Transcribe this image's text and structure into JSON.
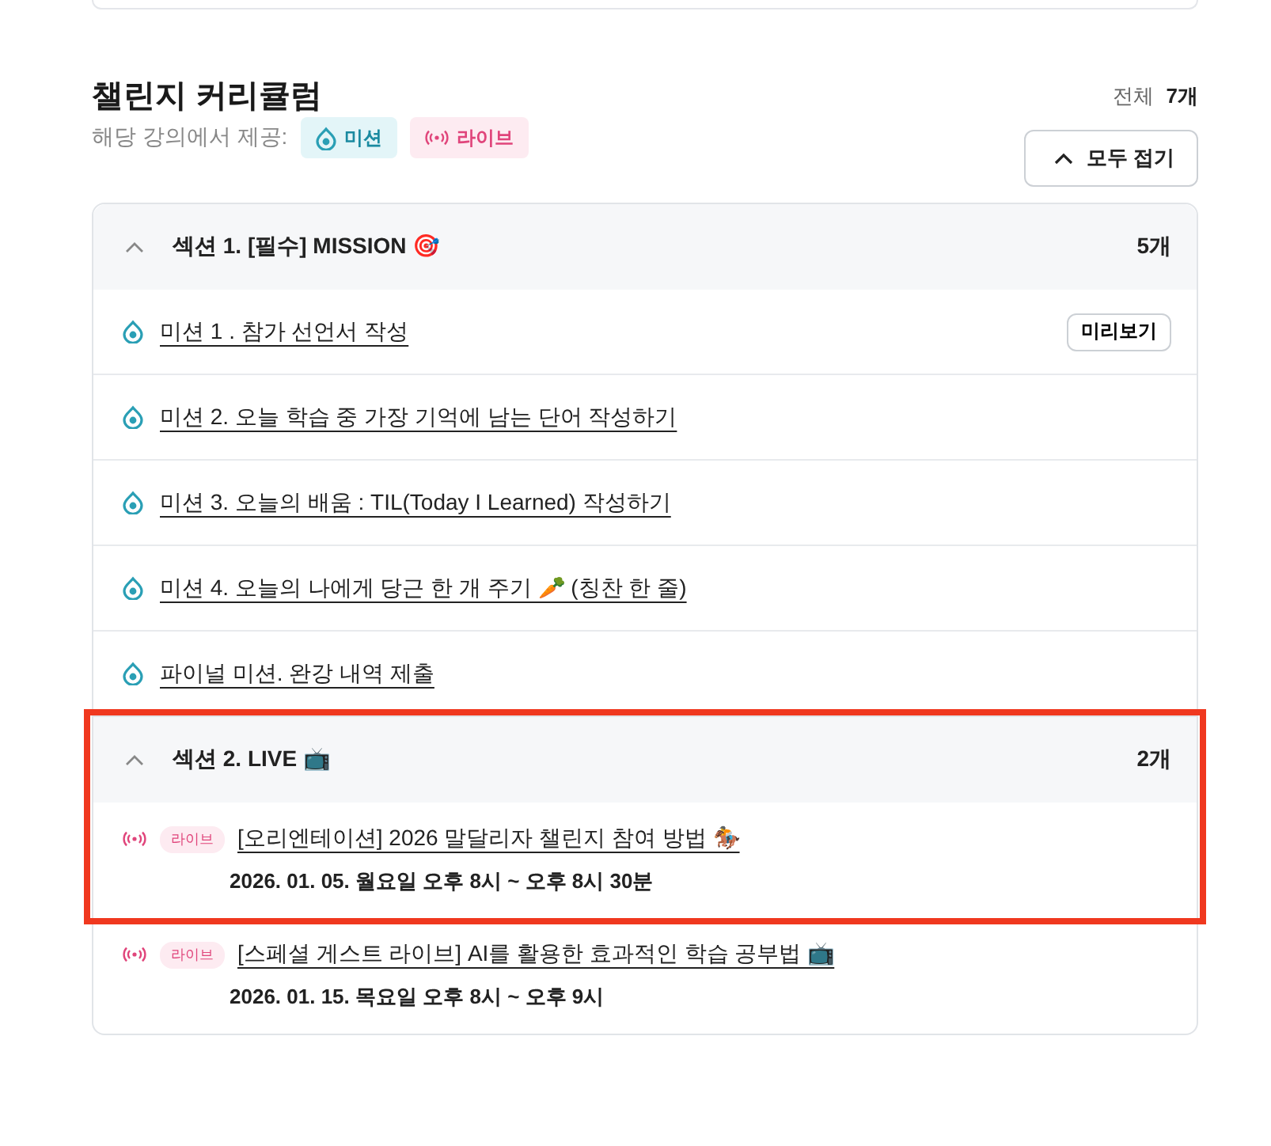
{
  "title": "챌린지 커리큘럼",
  "total": {
    "label": "전체",
    "count": "7개"
  },
  "provided": {
    "label": "해당 강의에서 제공:",
    "tags": [
      {
        "kind": "mission",
        "label": "미션"
      },
      {
        "kind": "live",
        "label": "라이브"
      }
    ]
  },
  "collapse_button": "모두 접기",
  "sections": [
    {
      "title": "섹션 1. [필수] MISSION 🎯",
      "count": "5개",
      "expanded": true,
      "highlighted": false,
      "items": [
        {
          "kind": "mission",
          "title": "미션 1 . 참가 선언서 작성",
          "preview": "미리보기",
          "highlighted": false
        },
        {
          "kind": "mission",
          "title": "미션 2. 오늘 학습 중 가장 기억에 남는 단어 작성하기",
          "highlighted": false
        },
        {
          "kind": "mission",
          "title": "미션 3. 오늘의 배움 : TIL(Today I Learned) 작성하기",
          "highlighted": false
        },
        {
          "kind": "mission",
          "title": "미션 4. 오늘의 나에게 당근 한 개 주기 🥕 (칭찬 한 줄)",
          "highlighted": false
        },
        {
          "kind": "mission",
          "title": "파이널 미션. 완강 내역 제출",
          "highlighted": false
        }
      ]
    },
    {
      "title": "섹션 2. LIVE 📺",
      "count": "2개",
      "expanded": true,
      "highlighted": true,
      "items": [
        {
          "kind": "live",
          "badge": "라이브",
          "title": "[오리엔테이션] 2026 말달리자 챌린지 참여 방법 🏇",
          "time": "2026. 01. 05. 월요일 오후 8시 ~ 오후 8시 30분",
          "highlighted": true
        },
        {
          "kind": "live",
          "badge": "라이브",
          "title": "[스페셜 게스트 라이브] AI를 활용한 효과적인 학습 공부법 📺",
          "time": "2026. 01. 15. 목요일 오후 8시 ~ 오후 9시",
          "highlighted": false
        }
      ]
    }
  ]
}
